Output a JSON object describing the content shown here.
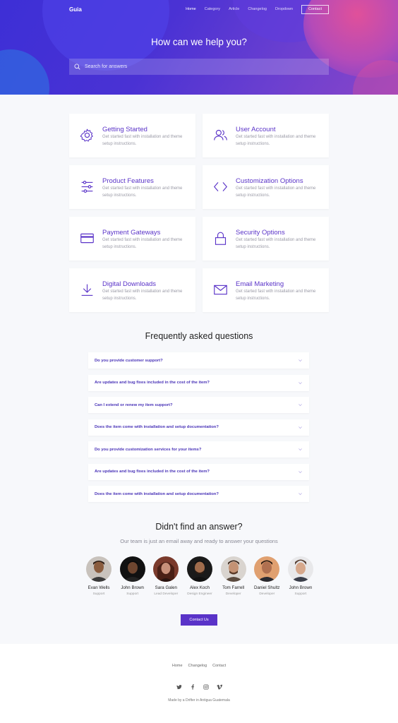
{
  "nav": {
    "logo": "Guia",
    "links": [
      "Home",
      "Category",
      "Article",
      "Changelog",
      "Dropdown"
    ],
    "contact": "Contact"
  },
  "hero": {
    "title": "How can we help you?",
    "search_placeholder": "Search for answers"
  },
  "cards": [
    {
      "title": "Getting Started",
      "desc": "Get started fast with installation and theme setup instructions.",
      "icon": "gear-icon"
    },
    {
      "title": "User Account",
      "desc": "Get started fast with installation and theme setup instructions.",
      "icon": "users-icon"
    },
    {
      "title": "Product Features",
      "desc": "Get started fast with installation and theme setup instructions.",
      "icon": "sliders-icon"
    },
    {
      "title": "Customization Options",
      "desc": "Get started fast with installation and theme setup instructions.",
      "icon": "code-icon"
    },
    {
      "title": "Payment Gateways",
      "desc": "Get started fast with installation and theme setup instructions.",
      "icon": "credit-card-icon"
    },
    {
      "title": "Security Options",
      "desc": "Get started fast with installation and theme setup instructions.",
      "icon": "lock-icon"
    },
    {
      "title": "Digital Downloads",
      "desc": "Get started fast with installation and theme setup instructions.",
      "icon": "download-icon"
    },
    {
      "title": "Email Marketing",
      "desc": "Get started fast with installation and theme setup instructions.",
      "icon": "mail-icon"
    }
  ],
  "faq": {
    "title": "Frequently asked questions",
    "items": [
      "Do you provide customer support?",
      "Are updates and bug fixes included in the cost of the item?",
      "Can I extend or renew my item support?",
      "Does the item come with installation and setup documentation?",
      "Do you provide customization services for your items?",
      "Are updates and bug fixes included in the cost of the item?",
      "Does the item come with installation and setup documentation?"
    ]
  },
  "team": {
    "title": "Didn't find an answer?",
    "subtitle": "Our team is just an email away and ready to answer your questions",
    "members": [
      {
        "name": "Evan Wells",
        "role": "Support"
      },
      {
        "name": "John Brown",
        "role": "Support"
      },
      {
        "name": "Sara Galen",
        "role": "Lead Developer"
      },
      {
        "name": "Alex Koch",
        "role": "Design Engineer"
      },
      {
        "name": "Tom Farrell",
        "role": "Developer"
      },
      {
        "name": "Daniel Shultz",
        "role": "Developer"
      },
      {
        "name": "John Brown",
        "role": "Support"
      }
    ],
    "contact_button": "Contact Us"
  },
  "footer": {
    "links": [
      "Home",
      "Changelog",
      "Contact"
    ],
    "social": [
      "twitter-icon",
      "facebook-icon",
      "instagram-icon",
      "vimeo-icon"
    ],
    "copyright": "Made by a Drifter in Antigua Guatemala"
  },
  "colors": {
    "accent": "#5a33c8",
    "hero_start": "#3d2fd6",
    "hero_end": "#8a46c8"
  }
}
